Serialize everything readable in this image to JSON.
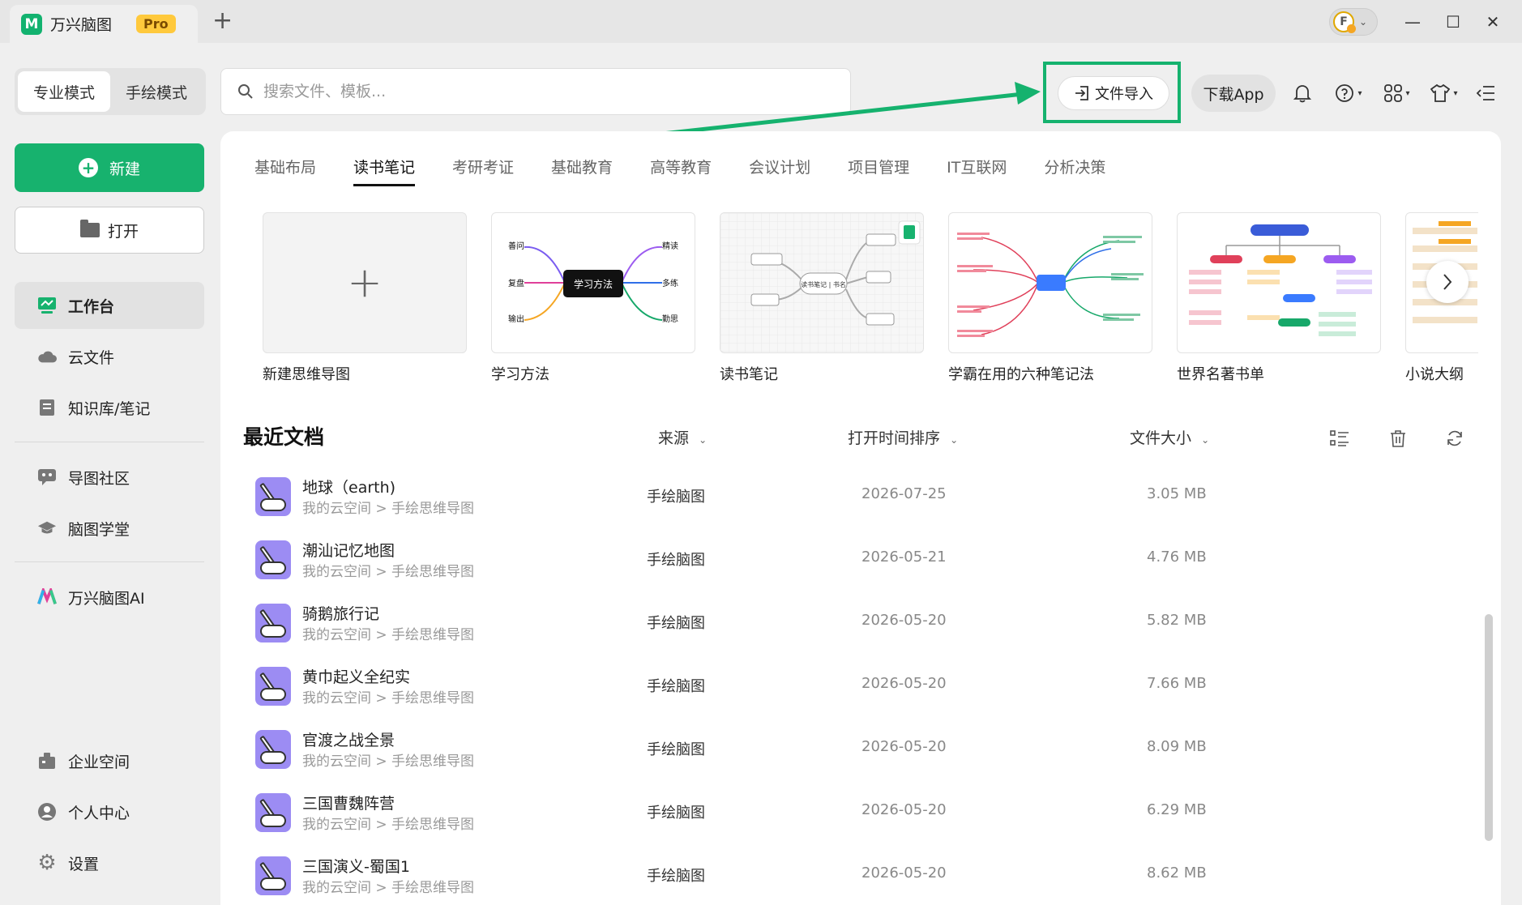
{
  "titlebar": {
    "app_name": "万兴脑图",
    "logo_glyph": "M",
    "pro_badge": "Pro",
    "new_tab": "+",
    "avatar_letter": "F",
    "window_controls": {
      "minimize": "—",
      "maximize": "☐",
      "close": "✕"
    }
  },
  "sidebar": {
    "modes": [
      "专业模式",
      "手绘模式"
    ],
    "active_mode": "专业模式",
    "new_button": "新建",
    "open_button": "打开",
    "nav": [
      {
        "label": "工作台",
        "icon": "workbench-icon",
        "active": true
      },
      {
        "label": "云文件",
        "icon": "cloud-icon"
      },
      {
        "label": "知识库/笔记",
        "icon": "note-icon"
      },
      {
        "label": "导图社区",
        "icon": "community-icon"
      },
      {
        "label": "脑图学堂",
        "icon": "graduation-cap-icon"
      },
      {
        "label": "万兴脑图AI",
        "icon": "ai-logo-icon"
      },
      {
        "label": "企业空间",
        "icon": "enterprise-icon"
      },
      {
        "label": "个人中心",
        "icon": "user-icon"
      },
      {
        "label": "设置",
        "icon": "gear-icon"
      }
    ]
  },
  "toolbar": {
    "search_placeholder": "搜索文件、模板...",
    "import_button": "文件导入",
    "download_app": "下载App"
  },
  "categories": {
    "tabs": [
      "基础布局",
      "读书笔记",
      "考研考证",
      "基础教育",
      "高等教育",
      "会议计划",
      "项目管理",
      "IT互联网",
      "分析决策"
    ],
    "active": "读书笔记"
  },
  "templates": [
    {
      "label": "新建思维导图",
      "kind": "blank"
    },
    {
      "label": "学习方法",
      "kind": "mindmap",
      "center": "学习方法",
      "left_nodes": [
        "善问",
        "复盘",
        "输出"
      ],
      "right_nodes": [
        "精读",
        "多练",
        "勤思"
      ]
    },
    {
      "label": "读书笔记",
      "kind": "mindmap-gray",
      "center": "读书笔记 | 书名"
    },
    {
      "label": "学霸在用的六种笔记法",
      "kind": "mindmap-colorful"
    },
    {
      "label": "世界名著书单",
      "kind": "tree-colorful"
    },
    {
      "label": "小说大纲",
      "kind": "table-outline"
    }
  ],
  "recent": {
    "title": "最近文档",
    "columns": {
      "source": "来源",
      "sort": "打开时间排序",
      "size": "文件大小"
    },
    "rows": [
      {
        "name": "地球（earth)",
        "path": "我的云空间 > 手绘思维导图",
        "source": "手绘脑图",
        "date": "2026-07-25",
        "size": "3.05 MB"
      },
      {
        "name": "潮汕记忆地图",
        "path": "我的云空间 > 手绘思维导图",
        "source": "手绘脑图",
        "date": "2026-05-21",
        "size": "4.76 MB"
      },
      {
        "name": "骑鹅旅行记",
        "path": "我的云空间 > 手绘思维导图",
        "source": "手绘脑图",
        "date": "2026-05-20",
        "size": "5.82 MB"
      },
      {
        "name": "黄巾起义全纪实",
        "path": "我的云空间 > 手绘思维导图",
        "source": "手绘脑图",
        "date": "2026-05-20",
        "size": "7.66 MB"
      },
      {
        "name": "官渡之战全景",
        "path": "我的云空间 > 手绘思维导图",
        "source": "手绘脑图",
        "date": "2026-05-20",
        "size": "8.09 MB"
      },
      {
        "name": "三国曹魏阵营",
        "path": "我的云空间 > 手绘思维导图",
        "source": "手绘脑图",
        "date": "2026-05-20",
        "size": "6.29 MB"
      },
      {
        "name": "三国演义-蜀国1",
        "path": "我的云空间 > 手绘思维导图",
        "source": "手绘脑图",
        "date": "2026-05-20",
        "size": "8.62 MB"
      }
    ]
  },
  "colors": {
    "accent": "#17b26e",
    "highlight_box": "#15b26e",
    "pro_badge": "#ffc93c",
    "doc_icon": "#9c8cf3"
  }
}
